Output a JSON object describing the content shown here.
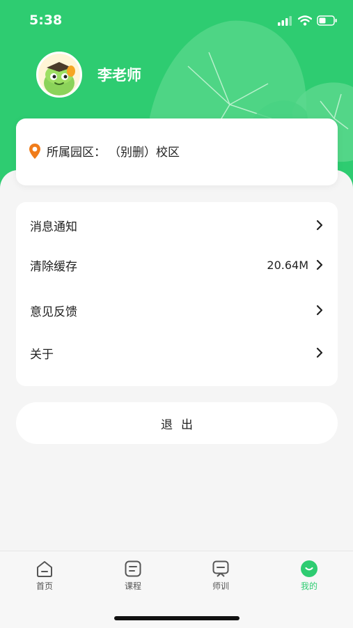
{
  "status_bar": {
    "time": "5:38"
  },
  "profile": {
    "name": "李老师"
  },
  "campus": {
    "label": "所属园区：",
    "value": "（别删）校区"
  },
  "menu": {
    "items": [
      {
        "label": "消息通知",
        "value": ""
      },
      {
        "label": "清除缓存",
        "value": "20.64M"
      },
      {
        "label": "意见反馈",
        "value": ""
      },
      {
        "label": "关于",
        "value": ""
      }
    ]
  },
  "logout_label": "退出",
  "tabs": [
    {
      "label": "首页",
      "icon": "home-icon",
      "active": false
    },
    {
      "label": "课程",
      "icon": "course-icon",
      "active": false
    },
    {
      "label": "师训",
      "icon": "training-icon",
      "active": false
    },
    {
      "label": "我的",
      "icon": "profile-icon",
      "active": true
    }
  ],
  "colors": {
    "accent": "#2ecc71",
    "location_pin": "#f07c1a",
    "background": "#f5f5f5"
  }
}
